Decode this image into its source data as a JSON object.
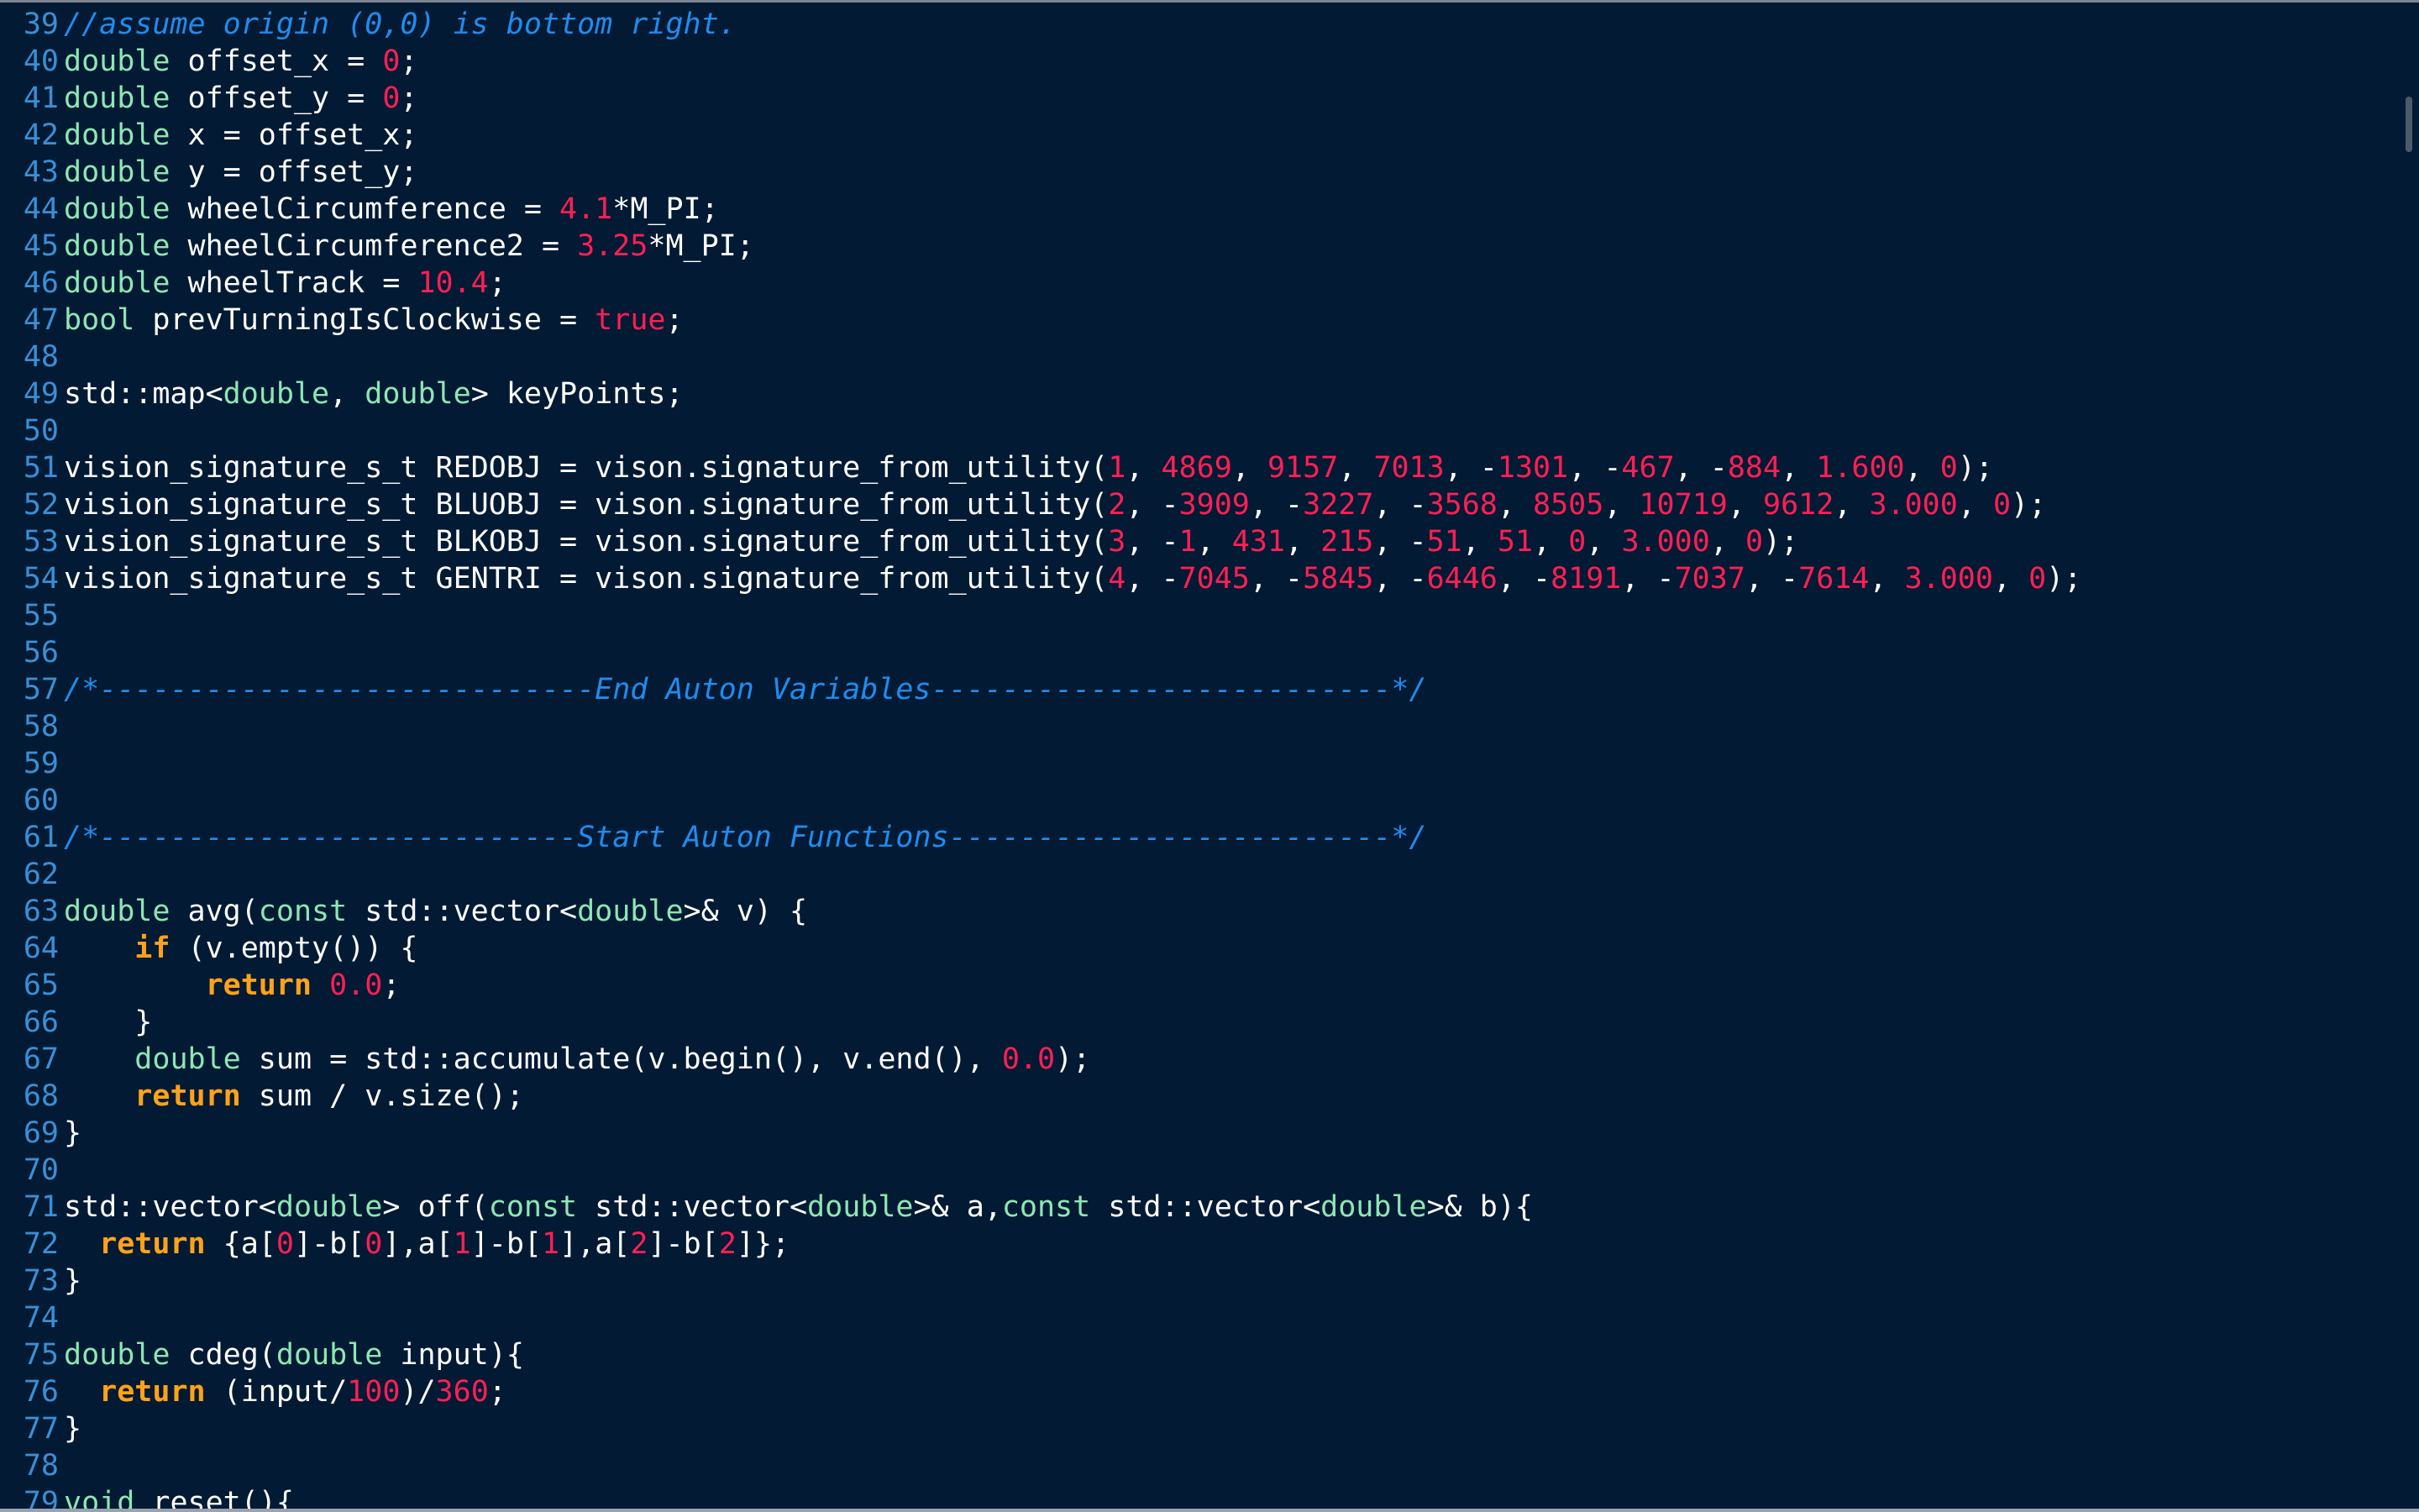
{
  "editor": {
    "lines": [
      {
        "num": "39",
        "tokens": [
          {
            "t": "comment",
            "v": "//assume origin (0,0) is bottom right."
          }
        ]
      },
      {
        "num": "40",
        "tokens": [
          {
            "t": "type",
            "v": "double"
          },
          {
            "t": "plain",
            "v": " offset_x = "
          },
          {
            "t": "num",
            "v": "0"
          },
          {
            "t": "plain",
            "v": ";"
          }
        ]
      },
      {
        "num": "41",
        "tokens": [
          {
            "t": "type",
            "v": "double"
          },
          {
            "t": "plain",
            "v": " offset_y = "
          },
          {
            "t": "num",
            "v": "0"
          },
          {
            "t": "plain",
            "v": ";"
          }
        ]
      },
      {
        "num": "42",
        "tokens": [
          {
            "t": "type",
            "v": "double"
          },
          {
            "t": "plain",
            "v": " x = offset_x;"
          }
        ]
      },
      {
        "num": "43",
        "tokens": [
          {
            "t": "type",
            "v": "double"
          },
          {
            "t": "plain",
            "v": " y = offset_y;"
          }
        ]
      },
      {
        "num": "44",
        "tokens": [
          {
            "t": "type",
            "v": "double"
          },
          {
            "t": "plain",
            "v": " wheelCircumference = "
          },
          {
            "t": "num",
            "v": "4.1"
          },
          {
            "t": "plain",
            "v": "*M_PI;"
          }
        ]
      },
      {
        "num": "45",
        "tokens": [
          {
            "t": "type",
            "v": "double"
          },
          {
            "t": "plain",
            "v": " wheelCircumference2 = "
          },
          {
            "t": "num",
            "v": "3.25"
          },
          {
            "t": "plain",
            "v": "*M_PI;"
          }
        ]
      },
      {
        "num": "46",
        "tokens": [
          {
            "t": "type",
            "v": "double"
          },
          {
            "t": "plain",
            "v": " wheelTrack = "
          },
          {
            "t": "num",
            "v": "10.4"
          },
          {
            "t": "plain",
            "v": ";"
          }
        ]
      },
      {
        "num": "47",
        "tokens": [
          {
            "t": "type",
            "v": "bool"
          },
          {
            "t": "plain",
            "v": " prevTurningIsClockwise = "
          },
          {
            "t": "num",
            "v": "true"
          },
          {
            "t": "plain",
            "v": ";"
          }
        ]
      },
      {
        "num": "48",
        "tokens": []
      },
      {
        "num": "49",
        "tokens": [
          {
            "t": "plain",
            "v": "std::map<"
          },
          {
            "t": "type",
            "v": "double"
          },
          {
            "t": "plain",
            "v": ", "
          },
          {
            "t": "type",
            "v": "double"
          },
          {
            "t": "plain",
            "v": "> keyPoints;"
          }
        ]
      },
      {
        "num": "50",
        "tokens": []
      },
      {
        "num": "51",
        "tokens": [
          {
            "t": "plain",
            "v": "vision_signature_s_t REDOBJ = vison.signature_from_utility("
          },
          {
            "t": "num",
            "v": "1"
          },
          {
            "t": "plain",
            "v": ", "
          },
          {
            "t": "num",
            "v": "4869"
          },
          {
            "t": "plain",
            "v": ", "
          },
          {
            "t": "num",
            "v": "9157"
          },
          {
            "t": "plain",
            "v": ", "
          },
          {
            "t": "num",
            "v": "7013"
          },
          {
            "t": "plain",
            "v": ", -"
          },
          {
            "t": "num",
            "v": "1301"
          },
          {
            "t": "plain",
            "v": ", -"
          },
          {
            "t": "num",
            "v": "467"
          },
          {
            "t": "plain",
            "v": ", -"
          },
          {
            "t": "num",
            "v": "884"
          },
          {
            "t": "plain",
            "v": ", "
          },
          {
            "t": "num",
            "v": "1.600"
          },
          {
            "t": "plain",
            "v": ", "
          },
          {
            "t": "num",
            "v": "0"
          },
          {
            "t": "plain",
            "v": ");"
          }
        ]
      },
      {
        "num": "52",
        "tokens": [
          {
            "t": "plain",
            "v": "vision_signature_s_t BLUOBJ = vison.signature_from_utility("
          },
          {
            "t": "num",
            "v": "2"
          },
          {
            "t": "plain",
            "v": ", -"
          },
          {
            "t": "num",
            "v": "3909"
          },
          {
            "t": "plain",
            "v": ", -"
          },
          {
            "t": "num",
            "v": "3227"
          },
          {
            "t": "plain",
            "v": ", -"
          },
          {
            "t": "num",
            "v": "3568"
          },
          {
            "t": "plain",
            "v": ", "
          },
          {
            "t": "num",
            "v": "8505"
          },
          {
            "t": "plain",
            "v": ", "
          },
          {
            "t": "num",
            "v": "10719"
          },
          {
            "t": "plain",
            "v": ", "
          },
          {
            "t": "num",
            "v": "9612"
          },
          {
            "t": "plain",
            "v": ", "
          },
          {
            "t": "num",
            "v": "3.000"
          },
          {
            "t": "plain",
            "v": ", "
          },
          {
            "t": "num",
            "v": "0"
          },
          {
            "t": "plain",
            "v": ");"
          }
        ]
      },
      {
        "num": "53",
        "tokens": [
          {
            "t": "plain",
            "v": "vision_signature_s_t BLKOBJ = vison.signature_from_utility("
          },
          {
            "t": "num",
            "v": "3"
          },
          {
            "t": "plain",
            "v": ", -"
          },
          {
            "t": "num",
            "v": "1"
          },
          {
            "t": "plain",
            "v": ", "
          },
          {
            "t": "num",
            "v": "431"
          },
          {
            "t": "plain",
            "v": ", "
          },
          {
            "t": "num",
            "v": "215"
          },
          {
            "t": "plain",
            "v": ", -"
          },
          {
            "t": "num",
            "v": "51"
          },
          {
            "t": "plain",
            "v": ", "
          },
          {
            "t": "num",
            "v": "51"
          },
          {
            "t": "plain",
            "v": ", "
          },
          {
            "t": "num",
            "v": "0"
          },
          {
            "t": "plain",
            "v": ", "
          },
          {
            "t": "num",
            "v": "3.000"
          },
          {
            "t": "plain",
            "v": ", "
          },
          {
            "t": "num",
            "v": "0"
          },
          {
            "t": "plain",
            "v": ");"
          }
        ]
      },
      {
        "num": "54",
        "tokens": [
          {
            "t": "plain",
            "v": "vision_signature_s_t GENTRI = vison.signature_from_utility("
          },
          {
            "t": "num",
            "v": "4"
          },
          {
            "t": "plain",
            "v": ", -"
          },
          {
            "t": "num",
            "v": "7045"
          },
          {
            "t": "plain",
            "v": ", -"
          },
          {
            "t": "num",
            "v": "5845"
          },
          {
            "t": "plain",
            "v": ", -"
          },
          {
            "t": "num",
            "v": "6446"
          },
          {
            "t": "plain",
            "v": ", -"
          },
          {
            "t": "num",
            "v": "8191"
          },
          {
            "t": "plain",
            "v": ", -"
          },
          {
            "t": "num",
            "v": "7037"
          },
          {
            "t": "plain",
            "v": ", -"
          },
          {
            "t": "num",
            "v": "7614"
          },
          {
            "t": "plain",
            "v": ", "
          },
          {
            "t": "num",
            "v": "3.000"
          },
          {
            "t": "plain",
            "v": ", "
          },
          {
            "t": "num",
            "v": "0"
          },
          {
            "t": "plain",
            "v": ");"
          }
        ]
      },
      {
        "num": "55",
        "tokens": []
      },
      {
        "num": "56",
        "tokens": []
      },
      {
        "num": "57",
        "tokens": [
          {
            "t": "comment",
            "v": "/*----------------------------End Auton Variables--------------------------*/"
          }
        ]
      },
      {
        "num": "58",
        "tokens": []
      },
      {
        "num": "59",
        "tokens": []
      },
      {
        "num": "60",
        "tokens": []
      },
      {
        "num": "61",
        "tokens": [
          {
            "t": "comment",
            "v": "/*---------------------------Start Auton Functions-------------------------*/"
          }
        ]
      },
      {
        "num": "62",
        "tokens": []
      },
      {
        "num": "63",
        "tokens": [
          {
            "t": "type",
            "v": "double"
          },
          {
            "t": "plain",
            "v": " avg("
          },
          {
            "t": "type",
            "v": "const"
          },
          {
            "t": "plain",
            "v": " std::vector<"
          },
          {
            "t": "type",
            "v": "double"
          },
          {
            "t": "plain",
            "v": ">& v) {"
          }
        ]
      },
      {
        "num": "64",
        "tokens": [
          {
            "t": "plain",
            "v": "    "
          },
          {
            "t": "kw",
            "v": "if"
          },
          {
            "t": "plain",
            "v": " (v.empty()) {"
          }
        ]
      },
      {
        "num": "65",
        "tokens": [
          {
            "t": "plain",
            "v": "        "
          },
          {
            "t": "kw",
            "v": "return"
          },
          {
            "t": "plain",
            "v": " "
          },
          {
            "t": "num",
            "v": "0.0"
          },
          {
            "t": "plain",
            "v": ";"
          }
        ]
      },
      {
        "num": "66",
        "tokens": [
          {
            "t": "plain",
            "v": "    }"
          }
        ]
      },
      {
        "num": "67",
        "tokens": [
          {
            "t": "plain",
            "v": "    "
          },
          {
            "t": "type",
            "v": "double"
          },
          {
            "t": "plain",
            "v": " sum = std::accumulate(v.begin(), v.end(), "
          },
          {
            "t": "num",
            "v": "0.0"
          },
          {
            "t": "plain",
            "v": ");"
          }
        ]
      },
      {
        "num": "68",
        "tokens": [
          {
            "t": "plain",
            "v": "    "
          },
          {
            "t": "kw",
            "v": "return"
          },
          {
            "t": "plain",
            "v": " sum / v.size();"
          }
        ]
      },
      {
        "num": "69",
        "tokens": [
          {
            "t": "plain",
            "v": "}"
          }
        ]
      },
      {
        "num": "70",
        "tokens": []
      },
      {
        "num": "71",
        "tokens": [
          {
            "t": "plain",
            "v": "std::vector<"
          },
          {
            "t": "type",
            "v": "double"
          },
          {
            "t": "plain",
            "v": "> off("
          },
          {
            "t": "type",
            "v": "const"
          },
          {
            "t": "plain",
            "v": " std::vector<"
          },
          {
            "t": "type",
            "v": "double"
          },
          {
            "t": "plain",
            "v": ">& a,"
          },
          {
            "t": "type",
            "v": "const"
          },
          {
            "t": "plain",
            "v": " std::vector<"
          },
          {
            "t": "type",
            "v": "double"
          },
          {
            "t": "plain",
            "v": ">& b){"
          }
        ]
      },
      {
        "num": "72",
        "tokens": [
          {
            "t": "plain",
            "v": "  "
          },
          {
            "t": "kw",
            "v": "return"
          },
          {
            "t": "plain",
            "v": " {a["
          },
          {
            "t": "num",
            "v": "0"
          },
          {
            "t": "plain",
            "v": "]-b["
          },
          {
            "t": "num",
            "v": "0"
          },
          {
            "t": "plain",
            "v": "],a["
          },
          {
            "t": "num",
            "v": "1"
          },
          {
            "t": "plain",
            "v": "]-b["
          },
          {
            "t": "num",
            "v": "1"
          },
          {
            "t": "plain",
            "v": "],a["
          },
          {
            "t": "num",
            "v": "2"
          },
          {
            "t": "plain",
            "v": "]-b["
          },
          {
            "t": "num",
            "v": "2"
          },
          {
            "t": "plain",
            "v": "]};"
          }
        ]
      },
      {
        "num": "73",
        "tokens": [
          {
            "t": "plain",
            "v": "}"
          }
        ]
      },
      {
        "num": "74",
        "tokens": []
      },
      {
        "num": "75",
        "tokens": [
          {
            "t": "type",
            "v": "double"
          },
          {
            "t": "plain",
            "v": " cdeg("
          },
          {
            "t": "type",
            "v": "double"
          },
          {
            "t": "plain",
            "v": " input){"
          }
        ]
      },
      {
        "num": "76",
        "tokens": [
          {
            "t": "plain",
            "v": "  "
          },
          {
            "t": "kw",
            "v": "return"
          },
          {
            "t": "plain",
            "v": " (input/"
          },
          {
            "t": "num",
            "v": "100"
          },
          {
            "t": "plain",
            "v": ")/"
          },
          {
            "t": "num",
            "v": "360"
          },
          {
            "t": "plain",
            "v": ";"
          }
        ]
      },
      {
        "num": "77",
        "tokens": [
          {
            "t": "plain",
            "v": "}"
          }
        ]
      },
      {
        "num": "78",
        "tokens": []
      },
      {
        "num": "79",
        "tokens": [
          {
            "t": "type",
            "v": "void"
          },
          {
            "t": "plain",
            "v": " reset(){"
          }
        ]
      }
    ]
  },
  "colors": {
    "background": "#021a33",
    "line_number": "#3a8fd6",
    "comment": "#1f8cf0",
    "type": "#8ee6b5",
    "number": "#ff1f55",
    "keyword": "#ffa21a",
    "text": "#ffffff"
  }
}
